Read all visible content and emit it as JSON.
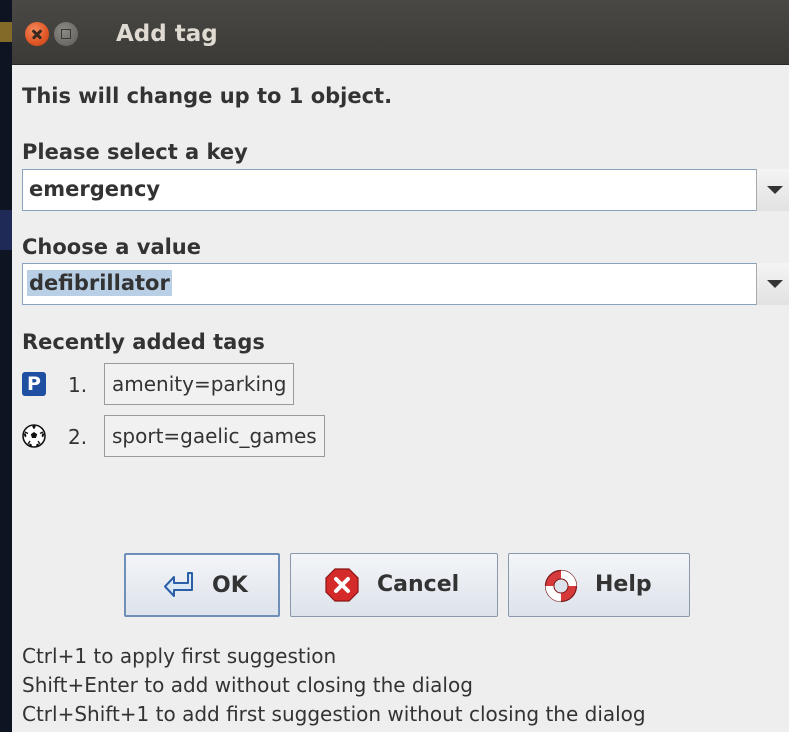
{
  "window": {
    "title": "Add tag"
  },
  "dialog": {
    "change_info": "This will change up to 1 object.",
    "key_label": "Please select a key",
    "key_value": "emergency",
    "value_label": "Choose a value",
    "value_value": "defibrillator",
    "recent_label": "Recently added tags",
    "recent_tags": [
      {
        "index": "1.",
        "tag": "amenity=parking",
        "icon": "parking-icon"
      },
      {
        "index": "2.",
        "tag": "sport=gaelic_games",
        "icon": "soccer-ball-icon"
      }
    ],
    "buttons": {
      "ok": "OK",
      "cancel": "Cancel",
      "help": "Help"
    },
    "hints": [
      "Ctrl+1 to apply first suggestion",
      "Shift+Enter to add without closing the dialog",
      "Ctrl+Shift+1 to add first suggestion without closing the dialog"
    ]
  },
  "icons": {
    "parking_letter": "P"
  },
  "colors": {
    "titlebar": "#3f3d39",
    "close": "#df5525",
    "selection": "#b8cfe5",
    "parking_blue": "#1e4fa0"
  }
}
